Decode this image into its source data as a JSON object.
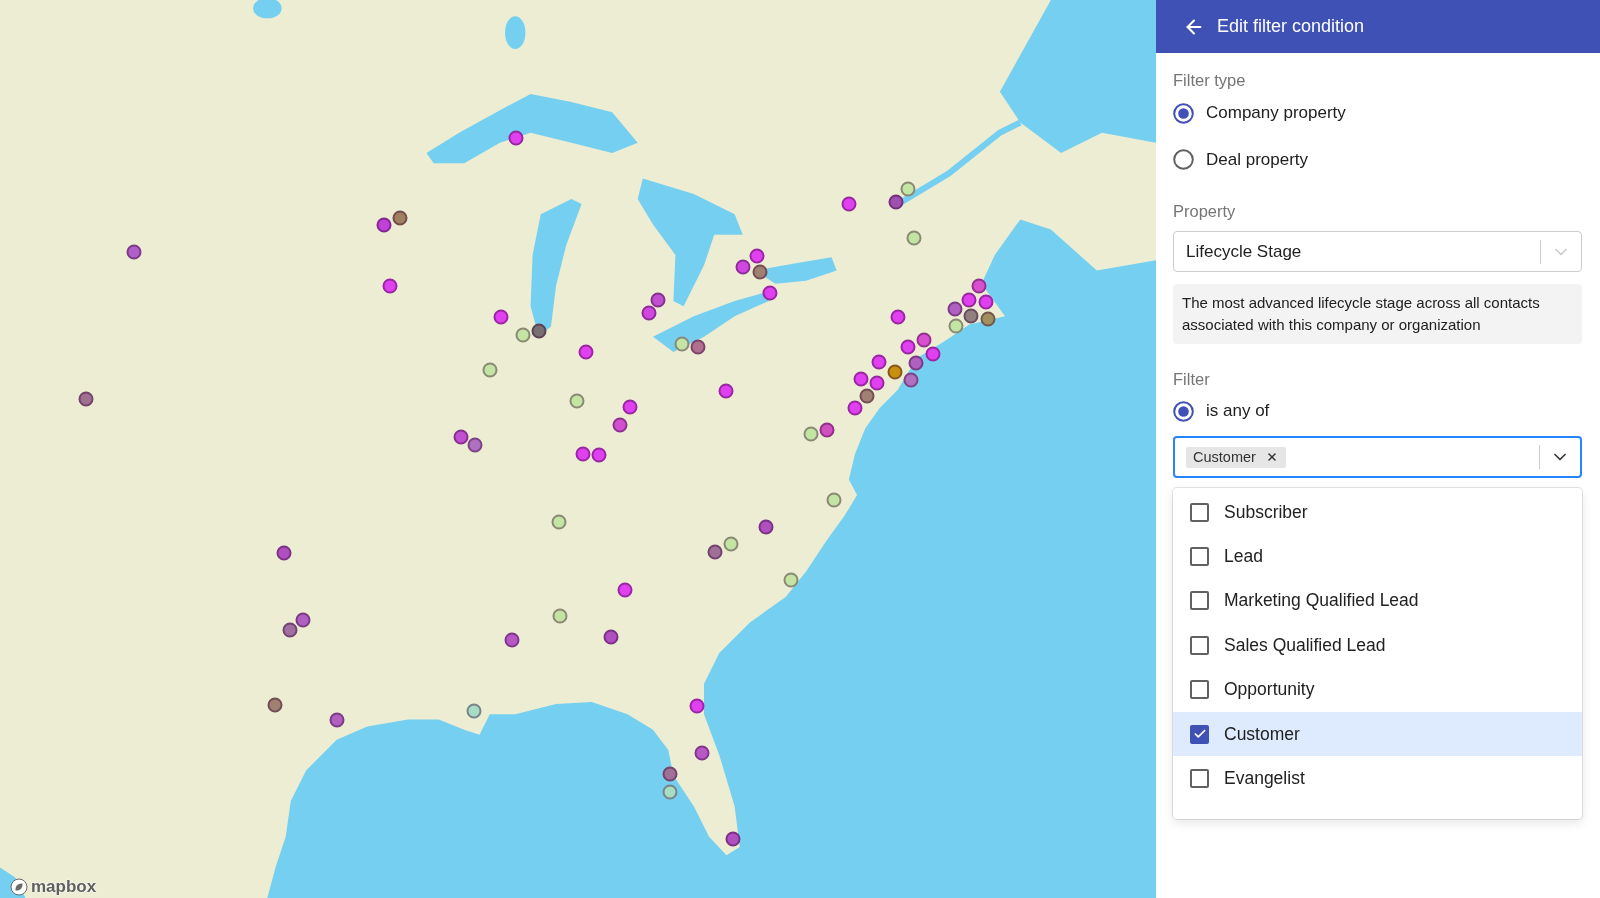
{
  "map": {
    "logo": "mapbox",
    "markers": [
      {
        "color": "#c4e4a4"
      },
      {
        "color": "#c4e4a4"
      },
      {
        "color": "#c4e4a4"
      },
      {
        "color": "#c4e4a4"
      },
      {
        "color": "#c4e4a4"
      },
      {
        "color": "#c4e4a4"
      },
      {
        "color": "#c4e4a4"
      },
      {
        "color": "#c4e4a4"
      },
      {
        "color": "#c4e4a4"
      },
      {
        "color": "#c4e4a4"
      },
      {
        "color": "#c4e4a4"
      },
      {
        "color": "#c4e4a4"
      },
      {
        "color": "#a8dcc4"
      },
      {
        "color": "#a8dcc4"
      },
      {
        "color": "#c4e4a4"
      },
      {
        "color": "#b060c8"
      },
      {
        "color": "#c040d8"
      },
      {
        "color": "#a08060"
      },
      {
        "color": "#e040f0"
      },
      {
        "color": "#e040f0"
      },
      {
        "color": "#e040f0"
      },
      {
        "color": "#787070"
      },
      {
        "color": "#e040f0"
      },
      {
        "color": "#a07090"
      },
      {
        "color": "#c050d0"
      },
      {
        "color": "#b070c0"
      },
      {
        "color": "#e040f0"
      },
      {
        "color": "#d050d0"
      },
      {
        "color": "#e040f0"
      },
      {
        "color": "#e040f0"
      },
      {
        "color": "#c050d0"
      },
      {
        "color": "#d048e0"
      },
      {
        "color": "#e040f0"
      },
      {
        "color": "#d048e0"
      },
      {
        "color": "#a08070"
      },
      {
        "color": "#e040f0"
      },
      {
        "color": "#b07090"
      },
      {
        "color": "#e040f0"
      },
      {
        "color": "#e040f0"
      },
      {
        "color": "#a050b0"
      },
      {
        "color": "#e040f0"
      },
      {
        "color": "#d850d0"
      },
      {
        "color": "#e040f0"
      },
      {
        "color": "#e040f0"
      },
      {
        "color": "#b060c0"
      },
      {
        "color": "#908080"
      },
      {
        "color": "#a09060"
      },
      {
        "color": "#e040f0"
      },
      {
        "color": "#e040f0"
      },
      {
        "color": "#d850d0"
      },
      {
        "color": "#b060c0"
      },
      {
        "color": "#b070c0"
      },
      {
        "color": "#e040f0"
      },
      {
        "color": "#c89010"
      },
      {
        "color": "#e040f0"
      },
      {
        "color": "#e040f0"
      },
      {
        "color": "#a08070"
      },
      {
        "color": "#e040f0"
      },
      {
        "color": "#d050c0"
      },
      {
        "color": "#b050c0"
      },
      {
        "color": "#a07098"
      },
      {
        "color": "#e040f0"
      },
      {
        "color": "#b858c8"
      },
      {
        "color": "#b050c0"
      },
      {
        "color": "#e040f0"
      },
      {
        "color": "#b858c8"
      },
      {
        "color": "#a07098"
      },
      {
        "color": "#b050c0"
      },
      {
        "color": "#b050c0"
      },
      {
        "color": "#b060c0"
      },
      {
        "color": "#a070a0"
      },
      {
        "color": "#a08070"
      },
      {
        "color": "#b060c0"
      }
    ]
  },
  "panel": {
    "header": {
      "title": "Edit filter condition"
    },
    "filter_type": {
      "label": "Filter type",
      "options": [
        {
          "label": "Company property",
          "selected": true
        },
        {
          "label": "Deal property",
          "selected": false
        }
      ]
    },
    "property": {
      "label": "Property",
      "value": "Lifecycle Stage",
      "description": "The most advanced lifecycle stage across all contacts associated with this company or organization"
    },
    "filter": {
      "label": "Filter",
      "operators": [
        {
          "label": "is any of",
          "selected": true
        }
      ],
      "chips": [
        {
          "label": "Customer"
        }
      ],
      "open": true,
      "options": [
        {
          "label": "Subscriber",
          "checked": false,
          "selected": false
        },
        {
          "label": "Lead",
          "checked": false,
          "selected": false
        },
        {
          "label": "Marketing Qualified Lead",
          "checked": false,
          "selected": false
        },
        {
          "label": "Sales Qualified Lead",
          "checked": false,
          "selected": false
        },
        {
          "label": "Opportunity",
          "checked": false,
          "selected": false
        },
        {
          "label": "Customer",
          "checked": true,
          "selected": true
        },
        {
          "label": "Evangelist",
          "checked": false,
          "selected": false
        }
      ]
    }
  }
}
